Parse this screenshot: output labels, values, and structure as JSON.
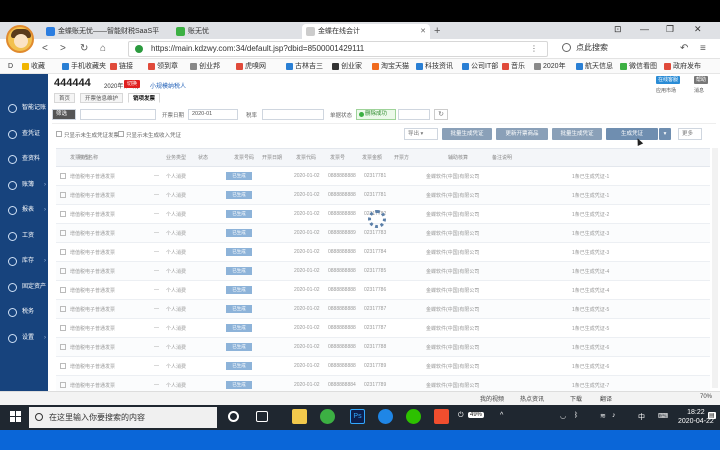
{
  "browser": {
    "tabs": [
      {
        "label": "金蝶账无忧——智能财税SaaS平",
        "fav_color": "#2b7de0",
        "active": false
      },
      {
        "label": "账无忧",
        "fav_color": "#3cb043",
        "active": false
      },
      {
        "label": "金蝶在线会计",
        "fav_color": "#cccccc",
        "active": true
      }
    ],
    "window_controls": [
      "⊡",
      "—",
      "❐",
      "✕"
    ],
    "url_host": "https://main.kdzwy.com",
    "url_path": ":34/default.jsp?dbid=8500001429111",
    "search_placeholder": "点此搜索",
    "bookmarks": [
      {
        "label": "收藏",
        "color": "#f0b400"
      },
      {
        "label": "手机收藏夹",
        "color": "#2a7fd4"
      },
      {
        "label": "链接",
        "color": "#e04a3a"
      },
      {
        "label": "领到章",
        "color": "#e04a3a"
      },
      {
        "label": "创业邦",
        "color": "#888888"
      },
      {
        "label": "虎嗅网",
        "color": "#e04a3a"
      },
      {
        "label": "古林吉三",
        "color": "#2a7fd4"
      },
      {
        "label": "创业家",
        "color": "#333333"
      },
      {
        "label": "淘宝天猫",
        "color": "#f06a1d"
      },
      {
        "label": "科技资讯",
        "color": "#2a7fd4"
      },
      {
        "label": "公司IT部",
        "color": "#2a7fd4"
      },
      {
        "label": "音乐",
        "color": "#e04a3a"
      },
      {
        "label": "2020年",
        "color": "#888888"
      },
      {
        "label": "航天信息",
        "color": "#2a7fd4"
      },
      {
        "label": "微信看图",
        "color": "#3cb043"
      },
      {
        "label": "政府发布",
        "color": "#e04a3a"
      }
    ]
  },
  "sidebar": {
    "items": [
      {
        "label": "智能记账"
      },
      {
        "label": "查凭证"
      },
      {
        "label": "查资料"
      },
      {
        "label": "账簿"
      },
      {
        "label": "报表"
      },
      {
        "label": "工资"
      },
      {
        "label": "库存"
      },
      {
        "label": "固定资产"
      },
      {
        "label": "税务"
      },
      {
        "label": "设置"
      }
    ]
  },
  "header": {
    "company": "444444",
    "period": "2020年第1期",
    "badge": "切换",
    "taxpayer": "小规模纳税人",
    "right_links": [
      "在线客服",
      "帮助"
    ],
    "right_sub": [
      "应用市场",
      "消息"
    ]
  },
  "app_tabs": [
    {
      "label": "首页",
      "active": false
    },
    {
      "label": "开票信息维护",
      "active": false
    },
    {
      "label": "销项发票",
      "active": true
    }
  ],
  "filters": {
    "type_select": "筛选",
    "label_date": "开票日期",
    "date_value": "2020-01",
    "label_tax": "税率",
    "label_status": "单据状态",
    "status_value": "删除成功",
    "refresh": "↻"
  },
  "checkboxes": [
    "只显示未生成凭证发票",
    "只显示未生成收入凭证"
  ],
  "actions": {
    "select_label": "导出 ▾",
    "buttons": [
      "批量生成凭证",
      "更新开票商品",
      "批量生成凭证",
      "生成凭证"
    ],
    "more": "▾",
    "more2": "更多"
  },
  "table": {
    "headers": [
      "发票类型",
      "购方名称",
      "业务类型",
      "状态",
      "发票号码",
      "开票日期",
      "发票代码",
      "发票号",
      "发票金额",
      "开票方",
      "辅助核算",
      "备注说明"
    ],
    "rows": [
      {
        "type": "增值税电子普通发票",
        "buyer": "个人消费",
        "status": "已生成",
        "date": "2020-01-02",
        "code": "0888888888",
        "no": "02317781",
        "issuer": "金蝶软件(中国)有限公司",
        "note": "1条已生成凭证-1"
      },
      {
        "type": "增值税电子普通发票",
        "buyer": "个人消费",
        "status": "已生成",
        "date": "2020-01-02",
        "code": "0888888888",
        "no": "02317781",
        "issuer": "金蝶软件(中国)有限公司",
        "note": "1条已生成凭证-1"
      },
      {
        "type": "增值税电子普通发票",
        "buyer": "个人消费",
        "status": "已生成",
        "date": "2020-01-02",
        "code": "0888888888",
        "no": "02317782",
        "issuer": "金蝶软件(中国)有限公司",
        "note": "1条已生成凭证-2"
      },
      {
        "type": "增值税电子普通发票",
        "buyer": "个人消费",
        "status": "已生成",
        "date": "2020-01-02",
        "code": "0888888889",
        "no": "02317783",
        "issuer": "金蝶软件(中国)有限公司",
        "note": "1条已生成凭证-3"
      },
      {
        "type": "增值税电子普通发票",
        "buyer": "个人消费",
        "status": "已生成",
        "date": "2020-01-02",
        "code": "0888888888",
        "no": "02317784",
        "issuer": "金蝶软件(中国)有限公司",
        "note": "1条已生成凭证-3"
      },
      {
        "type": "增值税电子普通发票",
        "buyer": "个人消费",
        "status": "已生成",
        "date": "2020-01-02",
        "code": "0888888888",
        "no": "02317785",
        "issuer": "金蝶软件(中国)有限公司",
        "note": "1条已生成凭证-4"
      },
      {
        "type": "增值税电子普通发票",
        "buyer": "个人消费",
        "status": "已生成",
        "date": "2020-01-02",
        "code": "0888888888",
        "no": "02317786",
        "issuer": "金蝶软件(中国)有限公司",
        "note": "1条已生成凭证-4"
      },
      {
        "type": "增值税电子普通发票",
        "buyer": "个人消费",
        "status": "已生成",
        "date": "2020-01-02",
        "code": "0888888888",
        "no": "02317787",
        "issuer": "金蝶软件(中国)有限公司",
        "note": "1条已生成凭证-5"
      },
      {
        "type": "增值税电子普通发票",
        "buyer": "个人消费",
        "status": "已生成",
        "date": "2020-01-02",
        "code": "0888888888",
        "no": "02317787",
        "issuer": "金蝶软件(中国)有限公司",
        "note": "1条已生成凭证-5"
      },
      {
        "type": "增值税电子普通发票",
        "buyer": "个人消费",
        "status": "已生成",
        "date": "2020-01-02",
        "code": "0888888888",
        "no": "02317788",
        "issuer": "金蝶软件(中国)有限公司",
        "note": "1条已生成凭证-6"
      },
      {
        "type": "增值税电子普通发票",
        "buyer": "个人消费",
        "status": "已生成",
        "date": "2020-01-02",
        "code": "0888888888",
        "no": "02317789",
        "issuer": "金蝶软件(中国)有限公司",
        "note": "1条已生成凭证-6"
      },
      {
        "type": "增值税电子普通发票",
        "buyer": "个人消费",
        "status": "已生成",
        "date": "2020-01-02",
        "code": "0888888884",
        "no": "02317789",
        "issuer": "金蝶软件(中国)有限公司",
        "note": "1条已生成凭证-7"
      }
    ]
  },
  "browser_status": {
    "left": "",
    "items": [
      "我的视频",
      "热点资讯",
      "下载",
      "翻译"
    ],
    "zoom": "70%"
  },
  "taskbar": {
    "search_placeholder": "在这里输入你要搜索的内容",
    "battery": "49%",
    "ime": "中",
    "time": "18:22",
    "date": "2020-04-22"
  },
  "colors": {
    "sidebar": "#17437d",
    "accent": "#2a8cd6",
    "badge": "#e02020",
    "taskbar": "#1f2730",
    "bottom_bar": "#0a66d8"
  }
}
